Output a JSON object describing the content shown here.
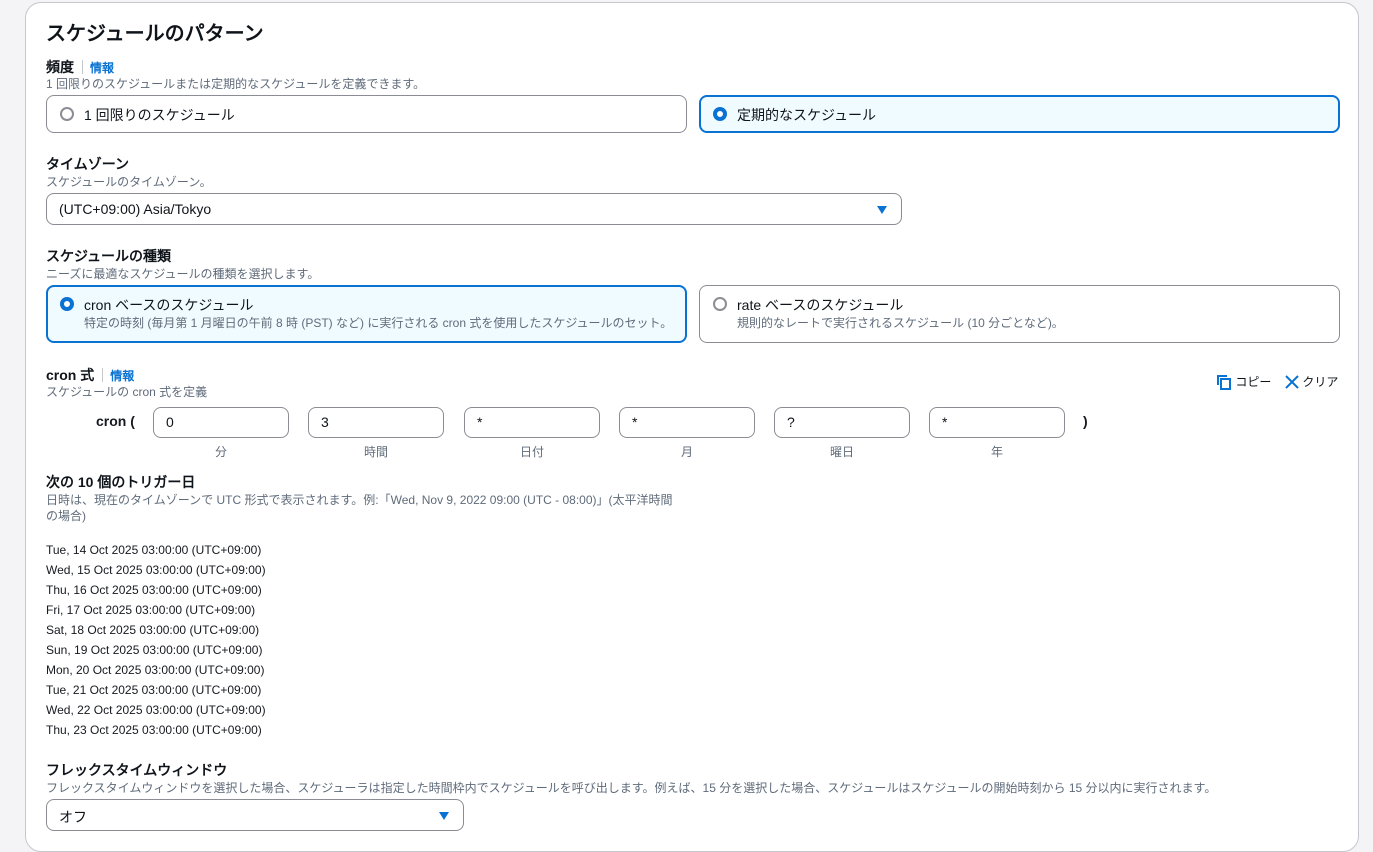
{
  "section": {
    "title": "スケジュールのパターン"
  },
  "frequency": {
    "label": "頻度",
    "info": "情報",
    "description": "1 回限りのスケジュールまたは定期的なスケジュールを定義できます。",
    "options": [
      {
        "label": "1 回限りのスケジュール",
        "selected": false
      },
      {
        "label": "定期的なスケジュール",
        "selected": true
      }
    ]
  },
  "timezone": {
    "label": "タイムゾーン",
    "description": "スケジュールのタイムゾーン。",
    "value": "(UTC+09:00) Asia/Tokyo"
  },
  "schedule_type": {
    "label": "スケジュールの種類",
    "description": "ニーズに最適なスケジュールの種類を選択します。",
    "options": [
      {
        "label": "cron ベースのスケジュール",
        "description": "特定の時刻 (毎月第 1 月曜日の午前 8 時 (PST) など) に実行される cron 式を使用したスケジュールのセット。",
        "selected": true
      },
      {
        "label": "rate ベースのスケジュール",
        "description": "規則的なレートで実行されるスケジュール (10 分ごとなど)。",
        "selected": false
      }
    ]
  },
  "cron": {
    "label": "cron 式",
    "info": "情報",
    "description": "スケジュールの cron 式を定義",
    "copy_label": "コピー",
    "clear_label": "クリア",
    "prefix": "cron (",
    "suffix": ")",
    "fields": [
      {
        "value": "0",
        "caption": "分"
      },
      {
        "value": "3",
        "caption": "時間"
      },
      {
        "value": "*",
        "caption": "日付"
      },
      {
        "value": "*",
        "caption": "月"
      },
      {
        "value": "?",
        "caption": "曜日"
      },
      {
        "value": "*",
        "caption": "年"
      }
    ]
  },
  "triggers": {
    "label": "次の 10 個のトリガー日",
    "description_line1": "日時は、現在のタイムゾーンで UTC 形式で表示されます。例:「Wed, Nov 9, 2022 09:00 (UTC - 08:00)」(太平洋時間",
    "description_line2": "の場合)",
    "dates": [
      "Tue, 14 Oct 2025 03:00:00 (UTC+09:00)",
      "Wed, 15 Oct 2025 03:00:00 (UTC+09:00)",
      "Thu, 16 Oct 2025 03:00:00 (UTC+09:00)",
      "Fri, 17 Oct 2025 03:00:00 (UTC+09:00)",
      "Sat, 18 Oct 2025 03:00:00 (UTC+09:00)",
      "Sun, 19 Oct 2025 03:00:00 (UTC+09:00)",
      "Mon, 20 Oct 2025 03:00:00 (UTC+09:00)",
      "Tue, 21 Oct 2025 03:00:00 (UTC+09:00)",
      "Wed, 22 Oct 2025 03:00:00 (UTC+09:00)",
      "Thu, 23 Oct 2025 03:00:00 (UTC+09:00)"
    ]
  },
  "flex_window": {
    "label": "フレックスタイムウィンドウ",
    "description": "フレックスタイムウィンドウを選択した場合、スケジューラは指定した時間枠内でスケジュールを呼び出します。例えば、15 分を選択した場合、スケジュールはスケジュールの開始時刻から 15 分以内に実行されます。",
    "value": "オフ"
  },
  "colors": {
    "accent": "#0972d3",
    "selected_bg": "#f0fbff",
    "border": "#8c8c94",
    "muted_text": "#5f6b7a"
  }
}
